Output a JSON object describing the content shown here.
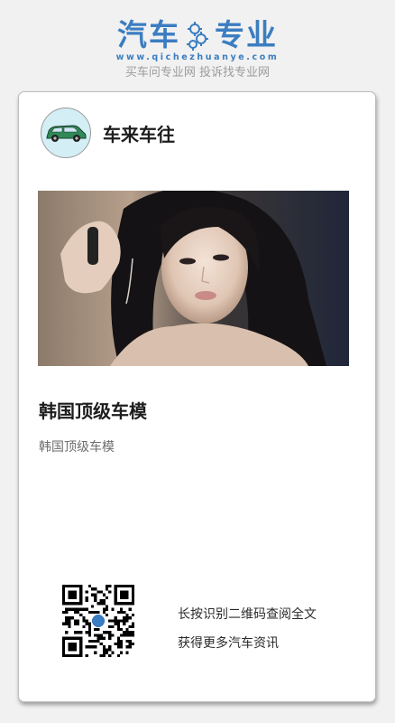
{
  "brand": {
    "title_left": "汽车",
    "title_right": "专业",
    "url": "www.qichezhuanye.com",
    "slogan": "买车问专业网 投诉找专业网",
    "color": "#3b7dc1"
  },
  "card": {
    "author_name": "车来车往",
    "avatar_icon": "car-icon",
    "article_title": "韩国顶级车模",
    "article_summary": "韩国顶级车模",
    "qr_icon": "qr-code",
    "qr_line1": "长按识别二维码查阅全文",
    "qr_line2": "获得更多汽车资讯"
  }
}
